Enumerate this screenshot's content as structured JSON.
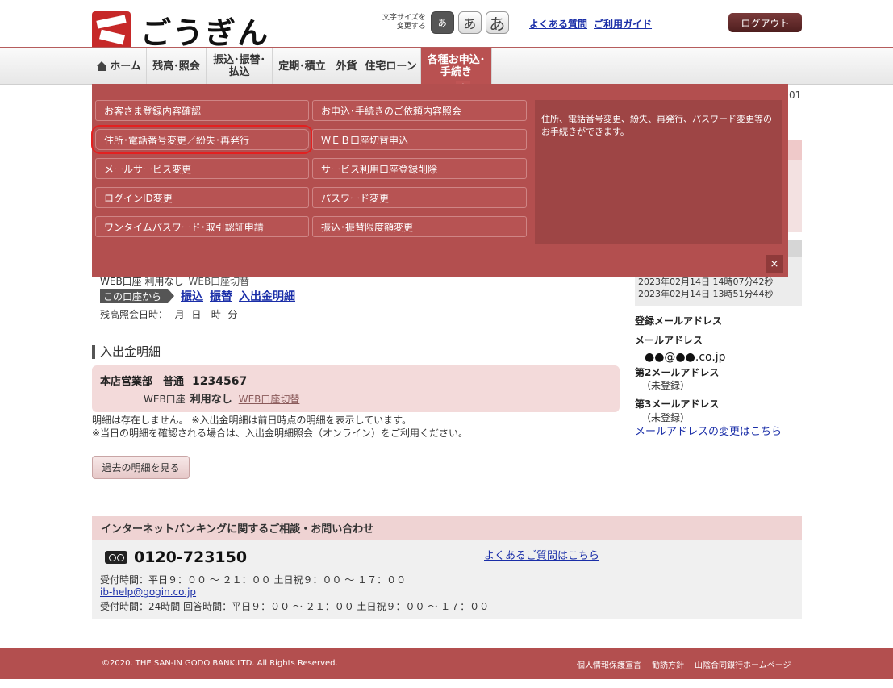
{
  "header": {
    "logo_text": "ごうぎん",
    "font_size_label_1": "文字サイズを",
    "font_size_label_2": "変更する",
    "font_sizes": [
      "あ",
      "あ",
      "あ"
    ],
    "faq_link": "よくある質問",
    "guide_link": "ご利用ガイド",
    "logout": "ログアウト"
  },
  "nav": [
    {
      "label": "ホーム"
    },
    {
      "label": "残高･照会"
    },
    {
      "label1": "振込･振替･",
      "label2": "払込"
    },
    {
      "label": "定期･積立"
    },
    {
      "label": "外貨"
    },
    {
      "label": "住宅ローン"
    },
    {
      "label1": "各種お申込･",
      "label2": "手続き"
    }
  ],
  "menu": {
    "col1": [
      "お客さま登録内容確認",
      "住所･電話番号変更／紛失･再発行",
      "メールサービス変更",
      "ログインID変更",
      "ワンタイムパスワード･取引認証申請"
    ],
    "col2": [
      "お申込･手続きのご依頼内容照会",
      "ＷＥＢ口座切替申込",
      "サービス利用口座登録削除",
      "パスワード変更",
      "振込･振替限度額変更"
    ],
    "description": "住所、電話番号変更、紛失、再発行、パスワード変更等のお手続きができます。",
    "close": "×"
  },
  "partial_date_suffix": "01",
  "account_summary": {
    "web_status": "WEB口座 利用なし",
    "web_switch": "WEB口座切替",
    "from_tag": "この口座から",
    "actions": [
      "振込",
      "振替",
      "入出金明細"
    ],
    "balance_time": "残高照会日時：--月--日 --時--分"
  },
  "login_history": [
    "2023年02月14日 14時07分42秒",
    "2023年02月14日 13時51分44秒"
  ],
  "transactions": {
    "title": "入出金明細",
    "branch": "本店営業部　普通",
    "account_no": "1234567",
    "web_label": "WEB口座",
    "web_value": "利用なし",
    "web_switch": "WEB口座切替",
    "note1": "明細は存在しません。 ※入出金明細は前日時点の明細を表示しています。",
    "note2": "※当日の明細を確認される場合は、入出金明細照会（オンライン）をご利用ください。",
    "past_button": "過去の明細を見る"
  },
  "emails": {
    "title": "登録メールアドレス",
    "label1": "メールアドレス",
    "value1": "●●@●●.co.jp",
    "label2": "第2メールアドレス",
    "value2": "（未登録）",
    "label3": "第3メールアドレス",
    "value3": "（未登録）",
    "change_link": "メールアドレスの変更はこちら"
  },
  "contact": {
    "header": "インターネットバンキングに関するご相談・お問い合わせ",
    "phone": "0120-723150",
    "faq_link": "よくあるご質問はこちら",
    "hours": "受付時間：平日９：００ ～ ２１：００ 土日祝９：００ ～ １７：００",
    "email": "ib-help@gogin.co.jp",
    "email_hours": "受付時間：24時間 回答時間：平日９：００ ～ ２１：００ 土日祝９：００ ～ １７：００"
  },
  "footer": {
    "copyright": "©2020. THE SAN-IN GODO BANK,LTD. All Rights Reserved.",
    "links": [
      "個人情報保護宣言",
      "勧誘方針",
      "山陰合同銀行ホームページ"
    ]
  },
  "colors": {
    "brand": "#b34f4f",
    "link": "#1a2ea8",
    "highlight_ring": "#e32020"
  }
}
